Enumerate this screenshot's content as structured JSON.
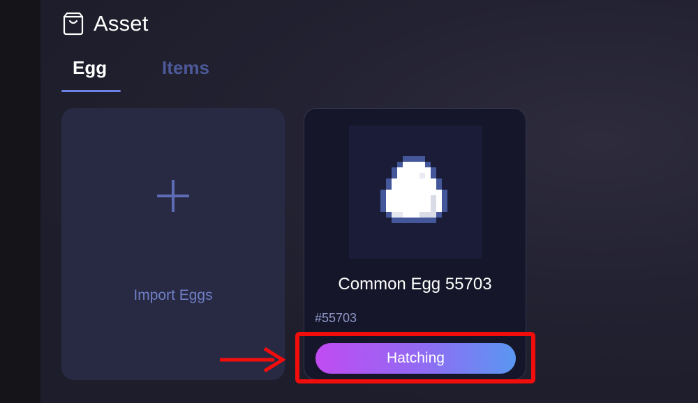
{
  "header": {
    "title": "Asset",
    "icon": "shopping-bag-icon"
  },
  "tabs": [
    {
      "label": "Egg",
      "active": true
    },
    {
      "label": "Items",
      "active": false
    }
  ],
  "import_card": {
    "label": "Import Eggs",
    "icon": "plus-icon"
  },
  "egg_card": {
    "name": "Common Egg 55703",
    "id": "#55703",
    "button_label": "Hatching",
    "icon": "egg-icon"
  },
  "colors": {
    "accent": "#6f80e6",
    "highlight": "#f20d0d",
    "button_gradient_start": "#c04bf2",
    "button_gradient_end": "#5a97f2"
  }
}
